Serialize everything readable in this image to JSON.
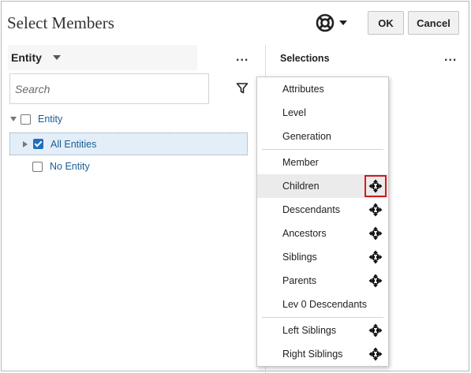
{
  "dialog": {
    "title": "Select Members",
    "ok_label": "OK",
    "cancel_label": "Cancel",
    "help_icon": "lifebuoy-icon"
  },
  "left_panel": {
    "dimension_label": "Entity",
    "more_label": "...",
    "search_placeholder": "Search",
    "tree": [
      {
        "label": "Entity",
        "checked": false,
        "expanded": true
      },
      {
        "label": "All Entities",
        "checked": true,
        "expanded": false,
        "selected": true
      },
      {
        "label": "No Entity",
        "checked": false
      }
    ]
  },
  "right_panel": {
    "title": "Selections",
    "more_label": "..."
  },
  "menu": {
    "items": [
      {
        "label": "Attributes",
        "has_icon": false
      },
      {
        "label": "Level",
        "has_icon": false
      },
      {
        "label": "Generation",
        "has_icon": false
      },
      {
        "label": "Member",
        "has_icon": false
      },
      {
        "label": "Children",
        "has_icon": true,
        "highlighted": true
      },
      {
        "label": "Descendants",
        "has_icon": true
      },
      {
        "label": "Ancestors",
        "has_icon": true
      },
      {
        "label": "Siblings",
        "has_icon": true
      },
      {
        "label": "Parents",
        "has_icon": true
      },
      {
        "label": "Lev 0 Descendants",
        "has_icon": false
      },
      {
        "label": "Left Siblings",
        "has_icon": true
      },
      {
        "label": "Right Siblings",
        "has_icon": true
      }
    ],
    "option_icon": "inclusive-selection-icon"
  },
  "colors": {
    "accent": "#1f6fbd",
    "link": "#1a5d95",
    "highlight_box": "#d11a1a",
    "selected_row": "#e4eef8"
  }
}
